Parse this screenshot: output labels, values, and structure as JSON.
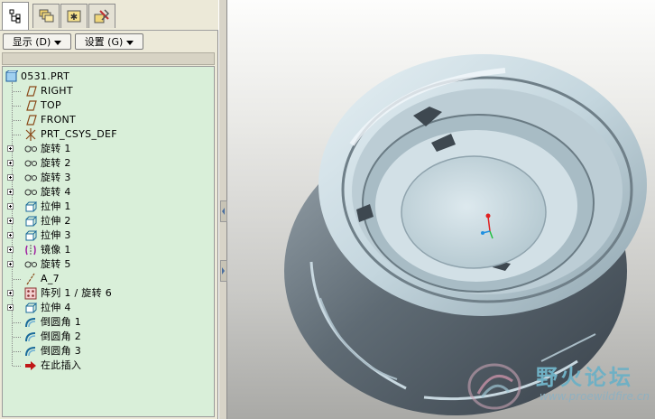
{
  "tabs": [
    {
      "icon": "model-tree-icon",
      "active": true
    },
    {
      "icon": "layers-icon",
      "active": false
    },
    {
      "icon": "favorites-icon",
      "active": false
    },
    {
      "icon": "tools-icon",
      "active": false
    }
  ],
  "buttons": {
    "show_label": "显示 (D)",
    "settings_label": "设置 (G)"
  },
  "tree": {
    "root": "0531.PRT",
    "items": [
      {
        "label": "RIGHT",
        "icon": "datum-plane-icon",
        "expandable": false
      },
      {
        "label": "TOP",
        "icon": "datum-plane-icon",
        "expandable": false
      },
      {
        "label": "FRONT",
        "icon": "datum-plane-icon",
        "expandable": false
      },
      {
        "label": "PRT_CSYS_DEF",
        "icon": "coordinate-system-icon",
        "expandable": false
      },
      {
        "label": "旋转 1",
        "icon": "revolve-icon",
        "expandable": true
      },
      {
        "label": "旋转 2",
        "icon": "revolve-icon",
        "expandable": true
      },
      {
        "label": "旋转 3",
        "icon": "revolve-icon",
        "expandable": true
      },
      {
        "label": "旋转 4",
        "icon": "revolve-icon",
        "expandable": true
      },
      {
        "label": "拉伸 1",
        "icon": "extrude-icon",
        "expandable": true
      },
      {
        "label": "拉伸 2",
        "icon": "extrude-icon",
        "expandable": true
      },
      {
        "label": "拉伸 3",
        "icon": "extrude-icon",
        "expandable": true
      },
      {
        "label": "镜像 1",
        "icon": "mirror-icon",
        "expandable": true
      },
      {
        "label": "旋转 5",
        "icon": "revolve-icon",
        "expandable": true
      },
      {
        "label": "A_7",
        "icon": "datum-axis-icon",
        "expandable": false
      },
      {
        "label": "阵列 1 / 旋转 6",
        "icon": "pattern-icon",
        "expandable": true
      },
      {
        "label": "拉伸 4",
        "icon": "extrude-icon",
        "expandable": true
      },
      {
        "label": "倒圆角 1",
        "icon": "round-icon",
        "expandable": false
      },
      {
        "label": "倒圆角 2",
        "icon": "round-icon",
        "expandable": false
      },
      {
        "label": "倒圆角 3",
        "icon": "round-icon",
        "expandable": false
      },
      {
        "label": "在此插入",
        "icon": "insert-here-arrow-icon",
        "expandable": false
      }
    ]
  },
  "watermark": {
    "title": "野火论坛",
    "url": "www.proewildfire.cn"
  },
  "colors": {
    "tree_background": "#d9efd9",
    "part_shade_light": "#d6e6ee",
    "part_shade_dark": "#4f5a64",
    "csys_red": "#e02020",
    "csys_green": "#20c040",
    "csys_blue": "#2090e0"
  }
}
